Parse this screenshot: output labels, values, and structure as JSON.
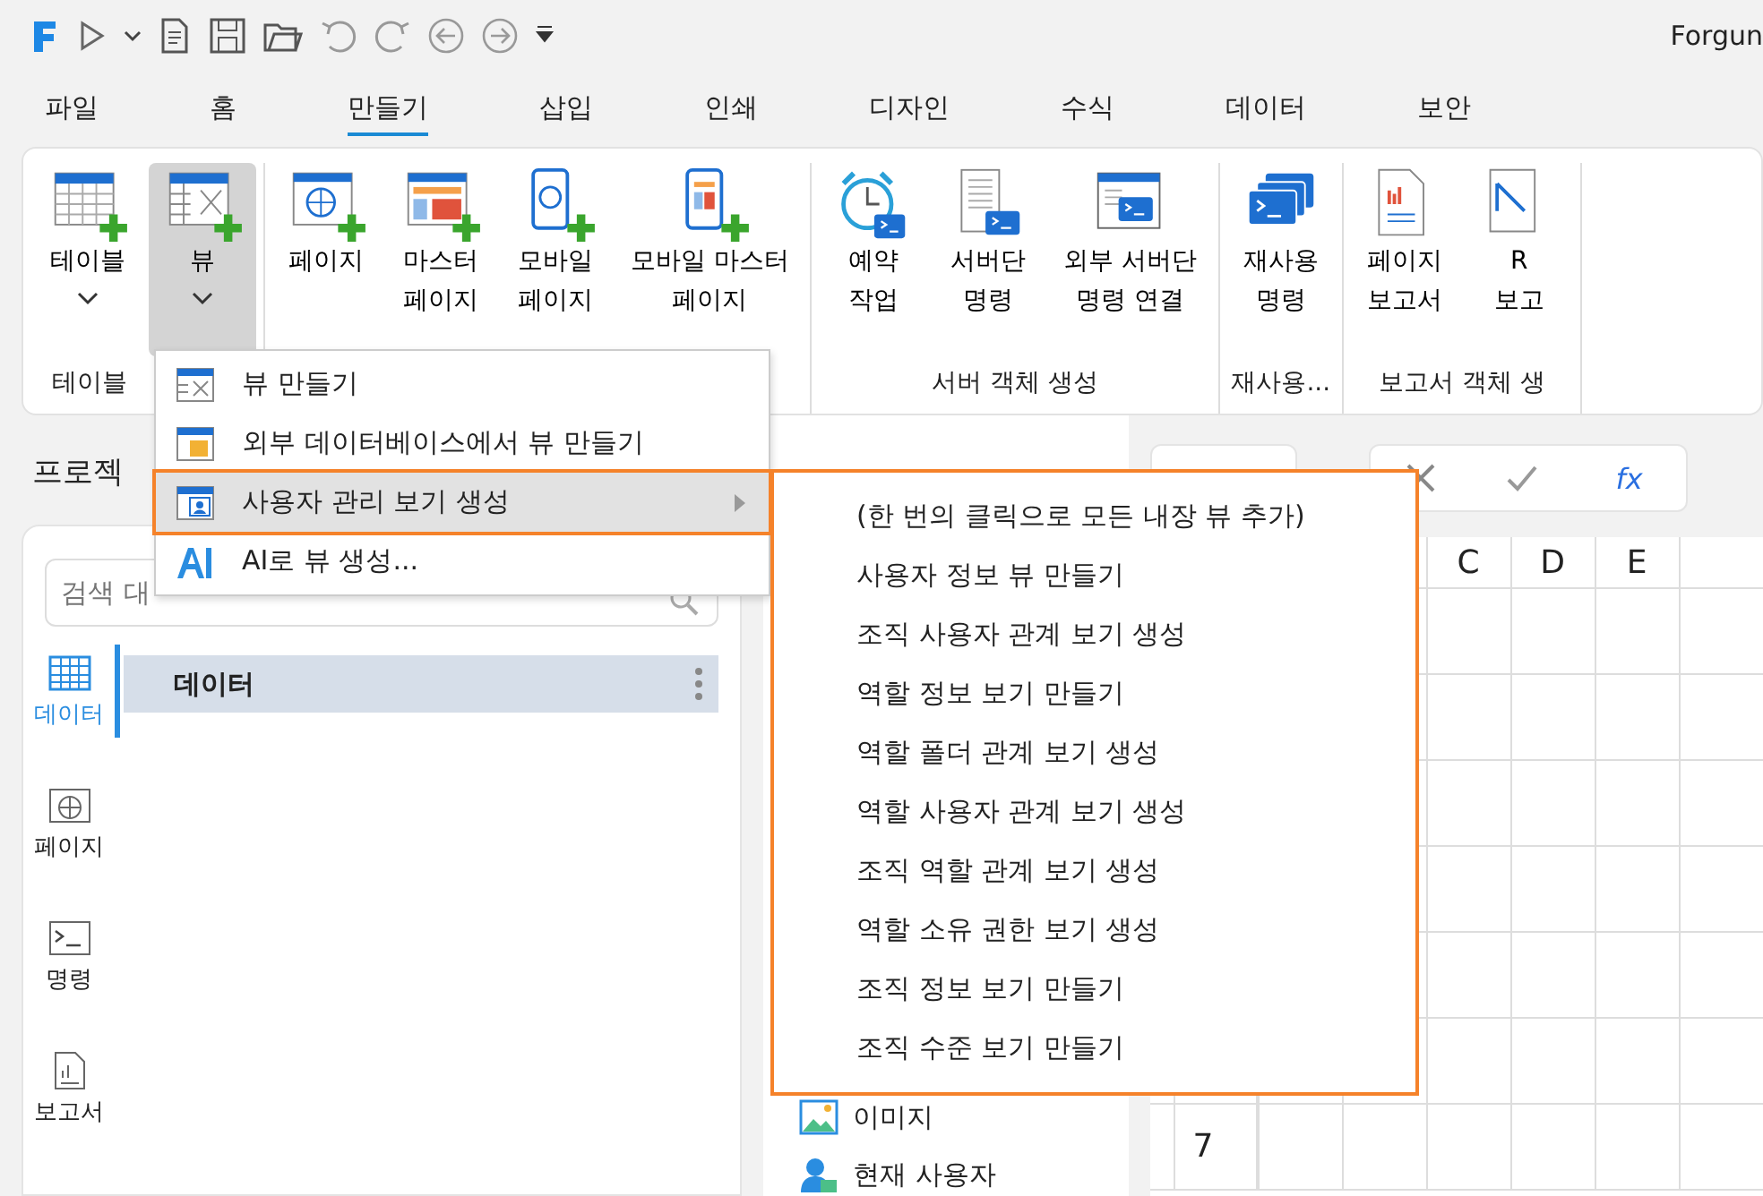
{
  "window": {
    "title": "Forgun"
  },
  "menu_tabs": [
    {
      "label": "파일",
      "selected": false
    },
    {
      "label": "홈",
      "selected": false
    },
    {
      "label": "만들기",
      "selected": true
    },
    {
      "label": "삽입",
      "selected": false
    },
    {
      "label": "인쇄",
      "selected": false
    },
    {
      "label": "디자인",
      "selected": false
    },
    {
      "label": "수식",
      "selected": false
    },
    {
      "label": "데이터",
      "selected": false
    },
    {
      "label": "보안",
      "selected": false
    }
  ],
  "ribbon": {
    "groups": [
      {
        "label": "테이블",
        "buttons": [
          {
            "label": "테이블",
            "kind": "table",
            "plus": true,
            "dropdown": true,
            "pressed": false
          },
          {
            "label": "뷰",
            "kind": "view",
            "plus": true,
            "dropdown": true,
            "pressed": true
          }
        ]
      },
      {
        "buttons": [
          {
            "label": "페이지",
            "kind": "page",
            "plus": true,
            "dropdown": false,
            "pressed": false
          },
          {
            "label": "마스터\n페이지",
            "kind": "master",
            "plus": true,
            "dropdown": false,
            "pressed": false
          },
          {
            "label": "모바일\n페이지",
            "kind": "mobile",
            "plus": true,
            "dropdown": false,
            "pressed": false
          },
          {
            "label": "모바일 마스터\n페이지",
            "kind": "mobile-master",
            "plus": true,
            "dropdown": false,
            "pressed": false
          }
        ]
      },
      {
        "label": "서버 객체 생성",
        "buttons": [
          {
            "label": "예약\n작업",
            "kind": "alarm",
            "plus": false,
            "dropdown": false,
            "pressed": false
          },
          {
            "label": "서버단\n명령",
            "kind": "server",
            "plus": false,
            "dropdown": false,
            "pressed": false
          },
          {
            "label": "외부 서버단\n명령 연결",
            "kind": "external",
            "plus": false,
            "dropdown": false,
            "pressed": false
          }
        ]
      },
      {
        "label": "재사용...",
        "buttons": [
          {
            "label": "재사용\n명령",
            "kind": "reuse",
            "plus": false,
            "dropdown": false,
            "pressed": false
          }
        ]
      },
      {
        "label": "보고서 객체 생",
        "buttons": [
          {
            "label": "페이지\n보고서",
            "kind": "report",
            "plus": false,
            "dropdown": false,
            "pressed": false
          },
          {
            "label": "R\n보고",
            "kind": "rdl",
            "plus": false,
            "dropdown": false,
            "pressed": false
          }
        ]
      }
    ]
  },
  "project_panel": {
    "title": "프로젝",
    "search": {
      "placeholder": "검색 대"
    },
    "nav": [
      {
        "label": "데이터",
        "kind": "grid",
        "selected": true
      },
      {
        "label": "페이지",
        "kind": "globe",
        "selected": false
      },
      {
        "label": "명령",
        "kind": "terminal",
        "selected": false
      },
      {
        "label": "보고서",
        "kind": "report",
        "selected": false
      }
    ],
    "tree": [
      {
        "label": "데이터",
        "selected": true
      }
    ]
  },
  "middle_panel": {
    "items": [
      {
        "label": "이미지",
        "kind": "image"
      },
      {
        "label": "현재 사용자",
        "kind": "user"
      }
    ]
  },
  "formula_bar": {
    "function_label": "fx"
  },
  "sheet": {
    "columns": [
      "C",
      "D",
      "E"
    ],
    "row_label": "7"
  },
  "dropdown": {
    "items": [
      {
        "label": "뷰 만들기",
        "kind": "view",
        "selected": false,
        "submenu": false,
        "callout": false
      },
      {
        "label": "외부 데이터베이스에서 뷰 만들기",
        "kind": "external-db",
        "selected": false,
        "submenu": false,
        "callout": false
      },
      {
        "label": "사용자 관리 보기 생성",
        "kind": "user-view",
        "selected": true,
        "submenu": true,
        "callout": true
      },
      {
        "label": "AI로 뷰 생성...",
        "kind": "ai",
        "selected": false,
        "submenu": false,
        "callout": false
      }
    ]
  },
  "submenu": {
    "callout": true,
    "items": [
      "(한 번의 클릭으로 모든 내장 뷰 추가)",
      "사용자 정보 뷰 만들기",
      "조직 사용자 관계 보기 생성",
      "역할 정보 보기 만들기",
      "역할 폴더 관계 보기 생성",
      "역할 사용자 관계 보기 생성",
      "조직 역할 관계 보기 생성",
      "역할 소유 권한 보기 생성",
      "조직 정보 보기 만들기",
      "조직 수준 보기 만들기"
    ]
  }
}
